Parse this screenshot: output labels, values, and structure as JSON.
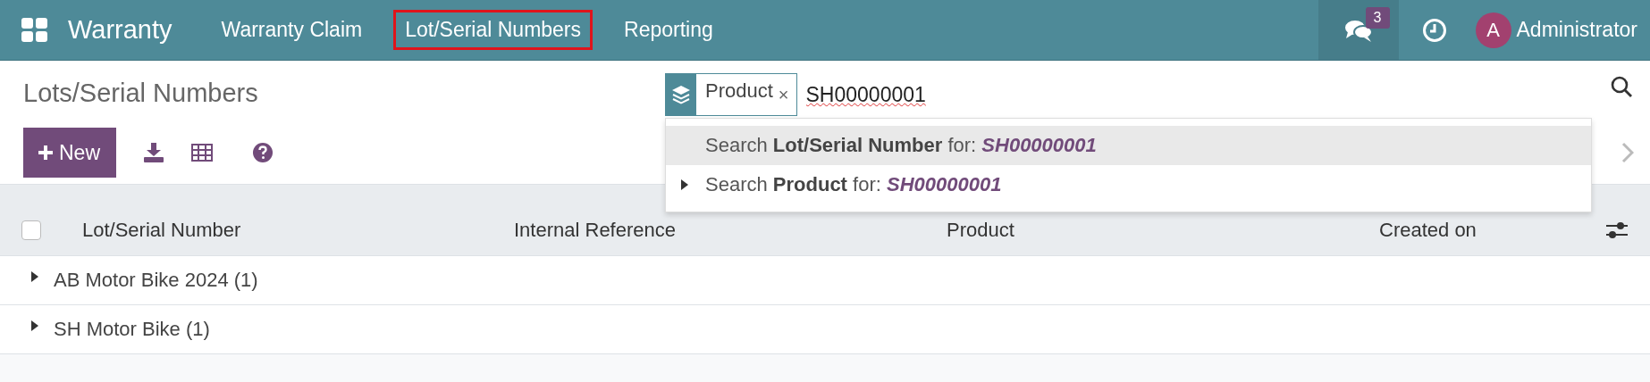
{
  "navbar": {
    "app_name": "Warranty",
    "menu": [
      {
        "label": "Warranty Claim",
        "highlighted": false
      },
      {
        "label": "Lot/Serial Numbers",
        "highlighted": true
      },
      {
        "label": "Reporting",
        "highlighted": false
      }
    ],
    "messages_badge": "3",
    "user": {
      "initial": "A",
      "name": "Administrator"
    }
  },
  "control_panel": {
    "title": "Lots/Serial Numbers",
    "new_button": "New"
  },
  "search": {
    "facets": [
      {
        "label": "Product",
        "remove": "×"
      }
    ],
    "value": "SH00000001",
    "suggestions": [
      {
        "text": "Search **Lot/Serial Number** for: *SH00000001*",
        "selected": true,
        "expandable": false
      },
      {
        "text": "Search **Product** for: *SH00000001*",
        "selected": false,
        "expandable": true
      }
    ]
  },
  "table": {
    "select_all": {
      "checked": false
    },
    "columns": [
      "Lot/Serial Number",
      "Internal Reference",
      "Product",
      "Created on"
    ],
    "groups": [
      {
        "label": "AB Motor Bike 2024 (1)",
        "expanded": false
      },
      {
        "label": "SH Motor Bike (1)",
        "expanded": false
      }
    ]
  }
}
